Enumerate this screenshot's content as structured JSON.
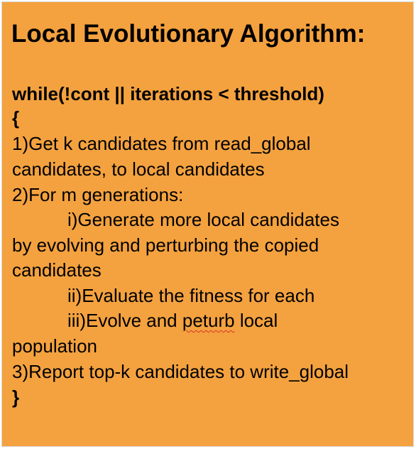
{
  "title": "Local Evolutionary Algorithm:",
  "loop_header": "while(!cont || iterations < threshold)",
  "brace_open": "{",
  "brace_close": "}",
  "lines": [
    "1)Get k candidates from read_global",
    "candidates, to local candidates",
    "2)For m generations:",
    "i)Generate more local candidates",
    "by evolving and perturbing the copied",
    "candidates",
    "ii)Evaluate the fitness for each",
    "population",
    "3)Report top-k candidates to write_global"
  ],
  "step_iii": {
    "prefix": "iii)Evolve and ",
    "misspelled_word": "peturb",
    "suffix": " local"
  },
  "colors": {
    "background": "#f4a23f",
    "text": "#000000",
    "spellcheck_underline": "#d9342b"
  }
}
